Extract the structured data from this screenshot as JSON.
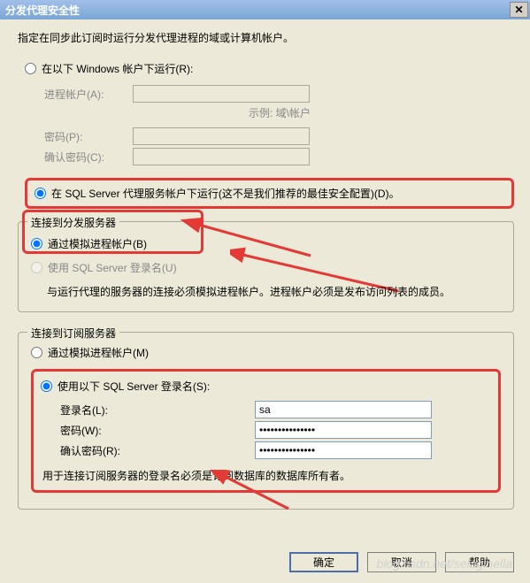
{
  "title": "分发代理安全性",
  "intro": "指定在同步此订阅时运行分发代理进程的域或计算机帐户。",
  "section1": {
    "radio_windows": "在以下 Windows 帐户下运行(R):",
    "process_account": "进程帐户(A):",
    "hint": "示例: 域\\帐户",
    "password": "密码(P):",
    "confirm": "确认密码(C):",
    "radio_sql": "在 SQL Server 代理服务帐户下运行(这不是我们推荐的最佳安全配置)(D)。"
  },
  "fieldset1": {
    "legend": "连接到分发服务器",
    "radio_impersonate": "通过模拟进程帐户(B)",
    "radio_sqllogin": "使用 SQL Server 登录名(U)",
    "note": "与运行代理的服务器的连接必须模拟进程帐户。进程帐户必须是发布访问列表的成员。"
  },
  "fieldset2": {
    "legend": "连接到订阅服务器",
    "radio_impersonate": "通过模拟进程帐户(M)",
    "radio_sqllogin": "使用以下 SQL Server 登录名(S):",
    "login": "登录名(L):",
    "login_value": "sa",
    "password": "密码(W):",
    "password_value": "***************",
    "confirm": "确认密码(R):",
    "confirm_value": "***************",
    "note": "用于连接订阅服务器的登录名必须是订阅数据库的数据库所有者。"
  },
  "buttons": {
    "ok": "确定",
    "cancel": "取消",
    "help": "帮助"
  },
  "watermark": "blog.csdn.net/selaginella"
}
